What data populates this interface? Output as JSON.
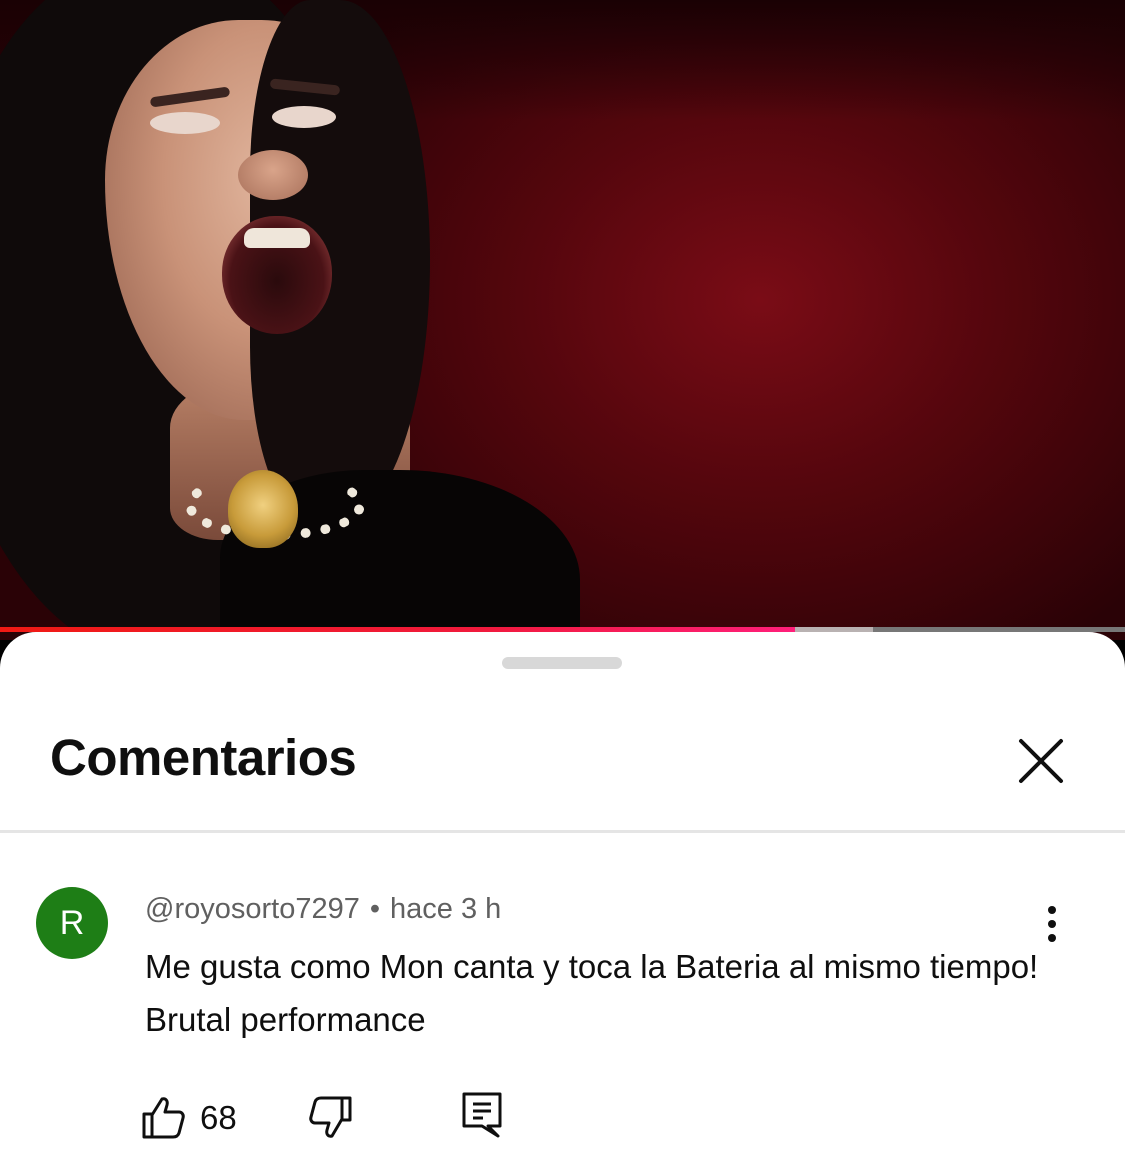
{
  "video": {
    "progress_fraction": 0.707,
    "buffered_fraction": 0.776,
    "colors": {
      "played_start": "#f01a14",
      "played_end": "#ff1f7a",
      "buffer": "#b9b2b2",
      "track": "#777777"
    }
  },
  "comments_sheet": {
    "title": "Comentarios",
    "close_icon": "close-icon"
  },
  "comments": [
    {
      "avatar_letter": "R",
      "avatar_color": "#1e7e16",
      "author": "@royosorto7297",
      "separator": "•",
      "time": "hace 3 h",
      "text": "Me gusta como Mon canta y toca la Bateria al mismo tiempo! Brutal performance",
      "likes": "68",
      "icons": {
        "more": "more-vertical-icon",
        "like": "thumbs-up-icon",
        "dislike": "thumbs-down-icon",
        "reply": "reply-comment-icon"
      }
    }
  ]
}
